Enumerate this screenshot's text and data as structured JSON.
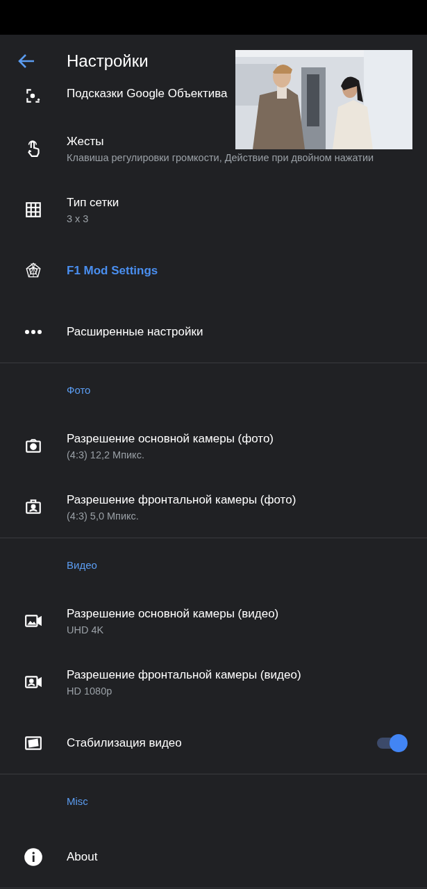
{
  "header": {
    "title": "Настройки"
  },
  "sections": [
    {
      "items": [
        {
          "kind": "text",
          "title": "Подсказки Google Объектива",
          "accent": false
        },
        {
          "kind": "text",
          "title": "Жесты",
          "subtitle": "Клавиша регулировки громкости, Действие при двойном нажатии",
          "accent": false
        },
        {
          "kind": "text",
          "title": "Тип сетки",
          "subtitle": "3 x 3",
          "accent": false
        },
        {
          "kind": "text",
          "title": "F1 Mod Settings",
          "accent": true
        },
        {
          "kind": "text",
          "title": "Расширенные настройки",
          "accent": false
        }
      ]
    },
    {
      "title": "Фото",
      "items": [
        {
          "kind": "text",
          "title": "Разрешение основной камеры (фото)",
          "subtitle": "(4:3) 12,2 Мпикс.",
          "accent": false
        },
        {
          "kind": "text",
          "title": "Разрешение фронтальной камеры (фото)",
          "subtitle": "(4:3) 5,0 Мпикс.",
          "accent": false
        }
      ]
    },
    {
      "title": "Видео",
      "items": [
        {
          "kind": "text",
          "title": "Разрешение основной камеры (видео)",
          "subtitle": "UHD 4K",
          "accent": false
        },
        {
          "kind": "text",
          "title": "Разрешение фронтальной камеры (видео)",
          "subtitle": "HD 1080p",
          "accent": false
        },
        {
          "kind": "toggle",
          "title": "Стабилизация видео",
          "on": true,
          "accent": false
        }
      ]
    },
    {
      "title": "Misc",
      "items": [
        {
          "kind": "text",
          "title": "About",
          "accent": false
        }
      ]
    }
  ]
}
